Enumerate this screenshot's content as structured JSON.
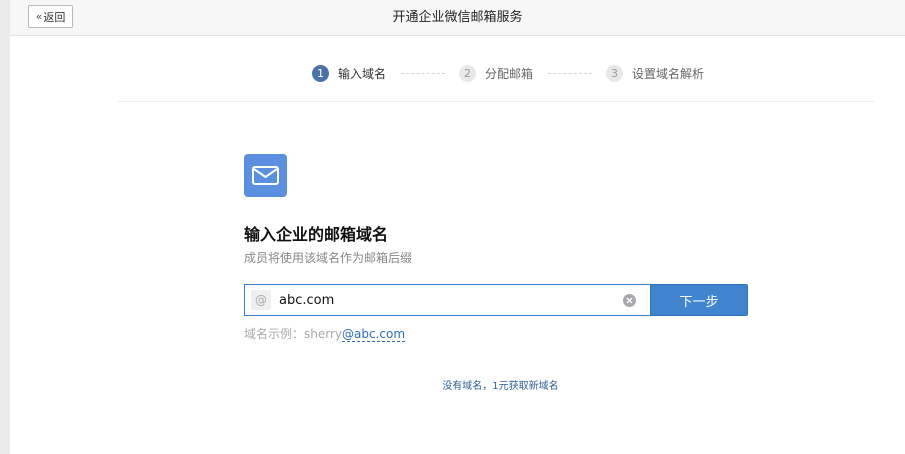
{
  "header": {
    "back_label": "返回",
    "back_chevron": "«",
    "title": "开通企业微信邮箱服务"
  },
  "steps": [
    {
      "num": "1",
      "label": "输入域名",
      "active": true
    },
    {
      "num": "2",
      "label": "分配邮箱",
      "active": false
    },
    {
      "num": "3",
      "label": "设置域名解析",
      "active": false
    }
  ],
  "main": {
    "icon": "mail-envelope-icon",
    "title": "输入企业的邮箱域名",
    "subtitle": "成员将使用该域名作为邮箱后缀",
    "at_symbol": "@",
    "domain_value": "abc.com",
    "next_label": "下一步",
    "example_prefix": "域名示例：sherry",
    "example_domain": "@abc.com",
    "buy_domain_link": "没有域名，1元获取新域名"
  },
  "colors": {
    "accent": "#3f84cc",
    "step_active": "#4a72a8",
    "icon_bg": "#5b8fe0"
  }
}
